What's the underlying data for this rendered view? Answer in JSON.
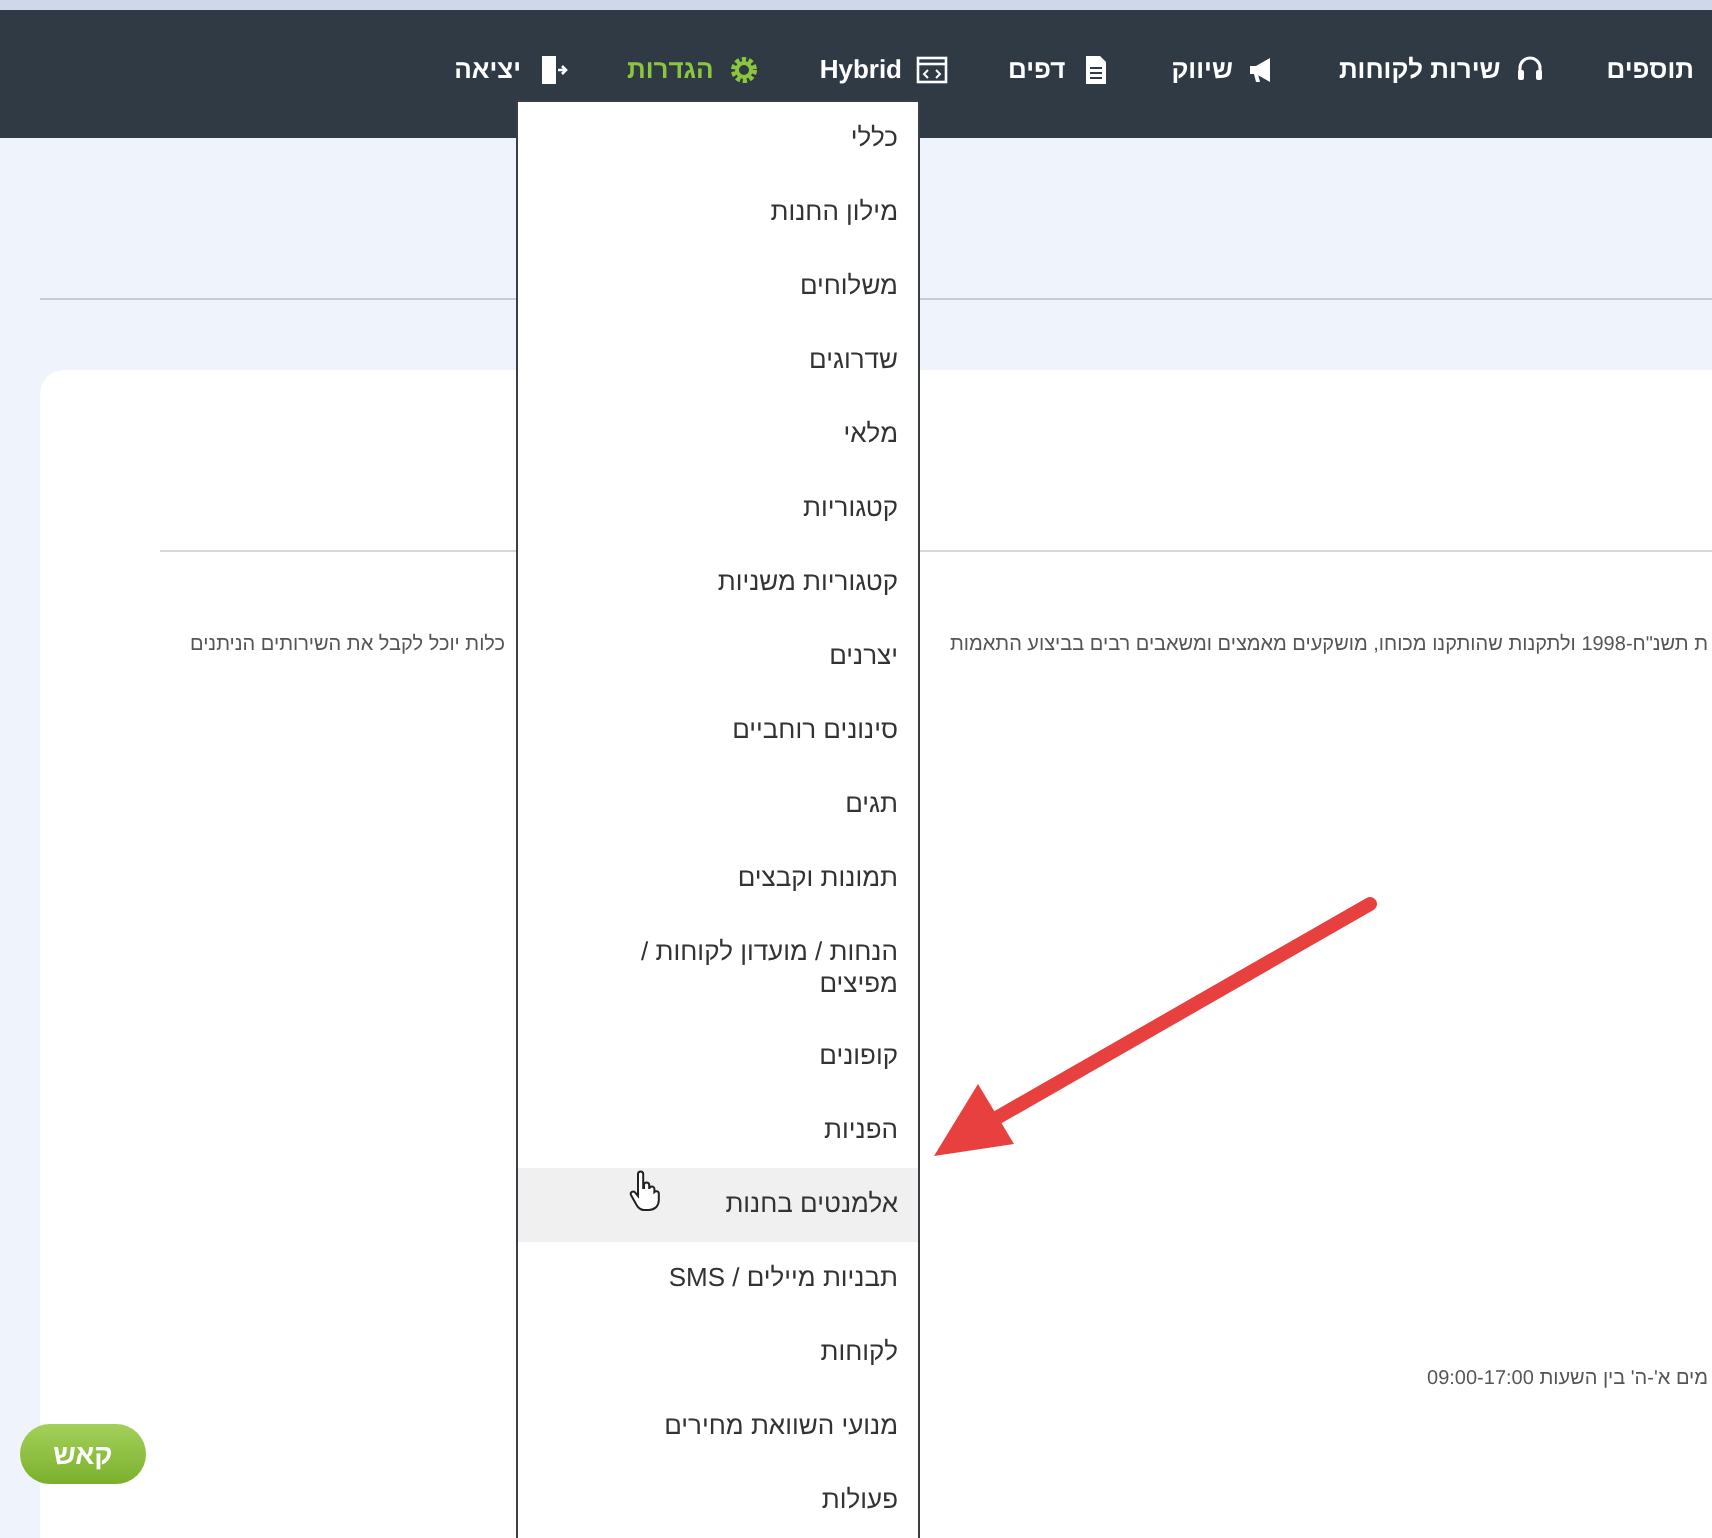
{
  "nav": [
    {
      "label": "תוספים",
      "selected": false
    },
    {
      "label": "שירות לקוחות",
      "selected": false
    },
    {
      "label": "שיווק",
      "selected": false
    },
    {
      "label": "דפים",
      "selected": false
    },
    {
      "label": "Hybrid",
      "selected": false
    },
    {
      "label": "הגדרות",
      "selected": true
    },
    {
      "label": "יציאה",
      "selected": false
    }
  ],
  "settings_menu": [
    {
      "label": "כללי",
      "selected": false
    },
    {
      "label": "מילון החנות",
      "selected": false
    },
    {
      "label": "משלוחים",
      "selected": false
    },
    {
      "label": "שדרוגים",
      "selected": false
    },
    {
      "label": "מלאי",
      "selected": false
    },
    {
      "label": "קטגוריות",
      "selected": false
    },
    {
      "label": "קטגוריות משניות",
      "selected": false
    },
    {
      "label": "יצרנים",
      "selected": false
    },
    {
      "label": "סינונים רוחביים",
      "selected": false
    },
    {
      "label": "תגים",
      "selected": false
    },
    {
      "label": "תמונות וקבצים",
      "selected": false
    },
    {
      "label": "הנחות / מועדון לקוחות / מפיצים",
      "selected": false
    },
    {
      "label": "קופונים",
      "selected": false
    },
    {
      "label": "הפניות",
      "selected": false
    },
    {
      "label": "אלמנטים בחנות",
      "selected": true
    },
    {
      "label": "תבניות מיילים / SMS",
      "selected": false
    },
    {
      "label": "לקוחות",
      "selected": false
    },
    {
      "label": "מנועי השוואת מחירים",
      "selected": false
    },
    {
      "label": "פעולות",
      "selected": false
    }
  ],
  "content": {
    "text_left": "כלות יוכל לקבל את השירותים הניתנים",
    "text_right": "ת תשנ\"ח-1998 ולתקנות שהותקנו מכוחו, מושקעים מאמצים ומשאבים רבים בביצוע התאמות",
    "hours": "מים א'-ה' בין השעות 09:00-17:00"
  },
  "kash_button": "קאש"
}
